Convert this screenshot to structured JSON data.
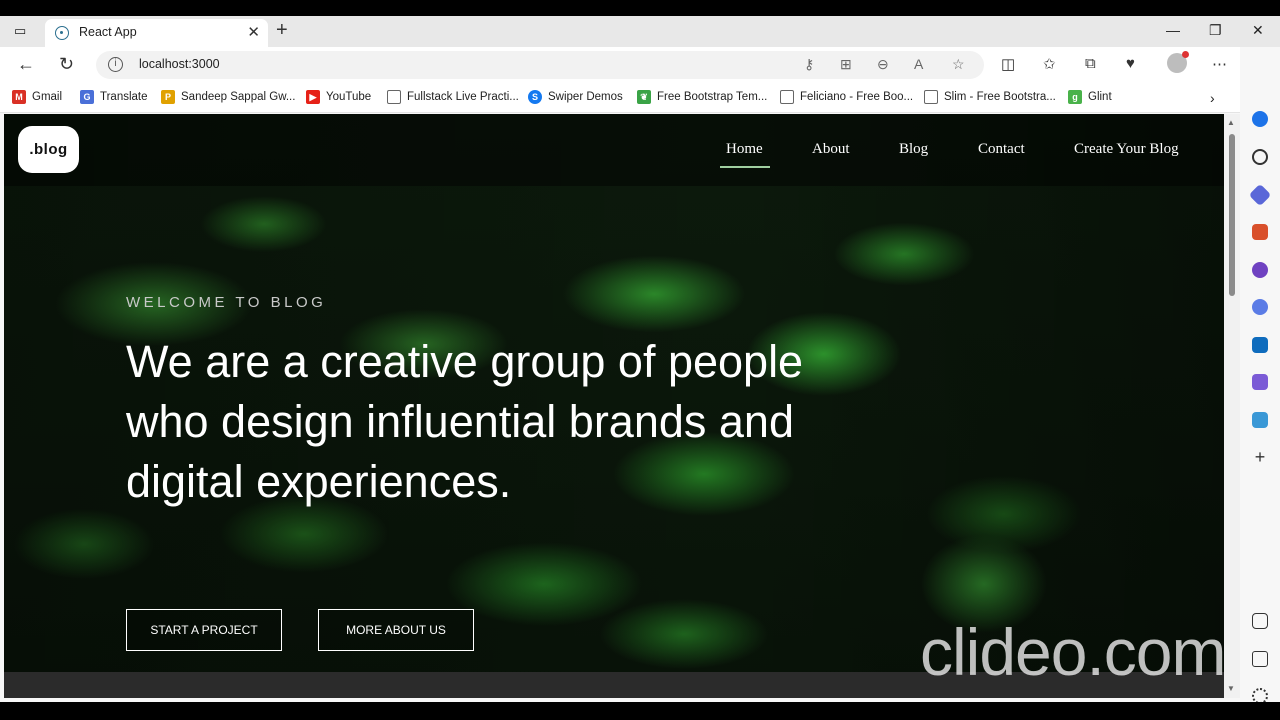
{
  "browser": {
    "tab": {
      "title": "React App"
    },
    "address": {
      "url": "localhost:3000"
    },
    "bookmarks": [
      {
        "label": "Gmail",
        "icon": "gmail-icon",
        "color": "#d93025"
      },
      {
        "label": "Translate",
        "icon": "translate-icon",
        "color": "#4a6fd8"
      },
      {
        "label": "Sandeep Sappal Gw...",
        "icon": "ps-icon",
        "color": "#e0a100"
      },
      {
        "label": "YouTube",
        "icon": "youtube-icon",
        "color": "#e62117"
      },
      {
        "label": "Fullstack Live Practi...",
        "icon": "page-icon",
        "color": "#666666"
      },
      {
        "label": "Swiper Demos",
        "icon": "swiper-icon",
        "color": "#1479f0"
      },
      {
        "label": "Free Bootstrap Tem...",
        "icon": "leaf-icon",
        "color": "#3aa346"
      },
      {
        "label": "Feliciano - Free Boo...",
        "icon": "page-icon",
        "color": "#666666"
      },
      {
        "label": "Slim - Free Bootstra...",
        "icon": "page-icon",
        "color": "#666666"
      },
      {
        "label": "Glint",
        "icon": "glint-icon",
        "color": "#49b24a"
      }
    ]
  },
  "site": {
    "logo": ".blog",
    "nav": [
      "Home",
      "About",
      "Blog",
      "Contact",
      "Create Your Blog"
    ],
    "kicker": "WELCOME TO BLOG",
    "headline": "We are a creative group of people who design influential brands and digital experiences.",
    "buttons": {
      "primary": "START A PROJECT",
      "secondary": "MORE ABOUT US"
    }
  },
  "watermark": "clideo.com"
}
